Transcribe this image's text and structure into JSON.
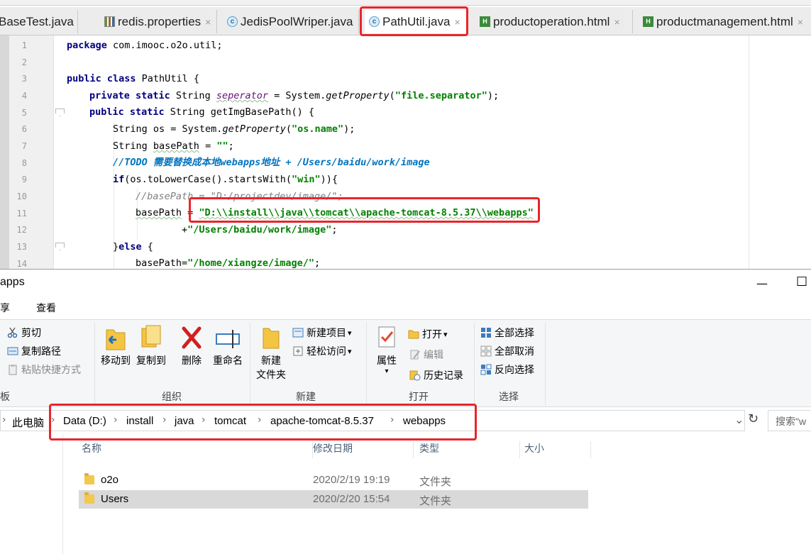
{
  "ide": {
    "tabs": [
      {
        "label": "BaseTest.java",
        "icon": "c"
      },
      {
        "label": "redis.properties",
        "icon": "prop"
      },
      {
        "label": "JedisPoolWriper.java",
        "icon": "c"
      },
      {
        "label": "PathUtil.java",
        "icon": "c",
        "active": true
      },
      {
        "label": "productoperation.html",
        "icon": "html"
      },
      {
        "label": "productmanagement.html",
        "icon": "html"
      }
    ],
    "close_glyph": "×",
    "line_numbers": [
      "1",
      "2",
      "3",
      "4",
      "5",
      "6",
      "7",
      "8",
      "9",
      "10",
      "11",
      "12",
      "13",
      "14"
    ],
    "code": {
      "l1_kw": "package",
      "l1_rest": " com.imooc.o2o.util;",
      "l3_kw": "public class",
      "l3_rest": " PathUtil {",
      "l4_kw": "private static",
      "l4_type": " String ",
      "l4_field": "seperator",
      "l4_eq": " = System.",
      "l4_call": "getProperty",
      "l4_open": "(",
      "l4_str": "\"file.separator\"",
      "l4_close": ");",
      "l5_kw": "public static",
      "l5_rest": " String getImgBasePath() {",
      "l6_a": "String os = System.",
      "l6_call": "getProperty",
      "l6_open": "(",
      "l6_str": "\"os.name\"",
      "l6_close": ");",
      "l7_a": "String ",
      "l7_var": "basePath",
      "l7_eq": " = ",
      "l7_str": "\"\"",
      "l7_close": ";",
      "l8_todo": "//TODO 需要替换成本地webapps地址 + /Users/baidu/work/image",
      "l9_kw": "if",
      "l9_a": "(os.toLowerCase().startsWith(",
      "l9_str": "\"win\"",
      "l9_close": ")){",
      "l10_cmt": "//basePath = \"D:/projectdev/image/\";",
      "l11_var": "basePath",
      "l11_eq": " = ",
      "l11_str": "\"D:\\\\install\\\\java\\\\tomcat\\\\apache-tomcat-8.5.37\\\\webapps\"",
      "l12_plus": "+",
      "l12_str": "\"/Users/baidu/work/image\"",
      "l12_close": ";",
      "l13_a": "}",
      "l13_kw": "else",
      "l13_close": " {",
      "l14_a": "basePath=",
      "l14_str": "\"/home/xiangze/image/\"",
      "l14_close": ";"
    }
  },
  "explorer": {
    "title": "apps",
    "window_buttons": {
      "minimize": "—",
      "maximize": "☐"
    },
    "menu": [
      "享",
      "查看"
    ],
    "ribbon": {
      "clipboard": {
        "cut": "剪切",
        "copy_path": "复制路径",
        "paste_shortcut": "粘贴快捷方式",
        "group_label": "板"
      },
      "organize": {
        "move_to": "移动到",
        "copy_to": "复制到",
        "delete": "删除",
        "rename": "重命名",
        "group_label": "组织"
      },
      "new": {
        "new_folder_1": "新建",
        "new_folder_2": "文件夹",
        "new_item": "新建项目",
        "easy_access": "轻松访问",
        "group_label": "新建"
      },
      "open": {
        "properties": "属性",
        "open": "打开",
        "edit": "编辑",
        "history": "历史记录",
        "group_label": "打开"
      },
      "select": {
        "select_all": "全部选择",
        "select_none": "全部取消",
        "invert": "反向选择",
        "group_label": "选择"
      },
      "dropdown_glyph": "▾"
    },
    "address": {
      "crumbs": [
        "此电脑",
        "Data (D:)",
        "install",
        "java",
        "tomcat",
        "apache-tomcat-8.5.37",
        "webapps"
      ],
      "separator": "›",
      "dropdown_glyph": "⌄",
      "refresh_glyph": "↻"
    },
    "search": {
      "placeholder": "搜索\"w"
    },
    "columns": {
      "name": "名称",
      "modified": "修改日期",
      "type": "类型",
      "size": "大小"
    },
    "files": [
      {
        "name": "o2o",
        "modified": "2020/2/19 19:19",
        "type": "文件夹"
      },
      {
        "name": "Users",
        "modified": "2020/2/20 15:54",
        "type": "文件夹",
        "selected": true
      }
    ]
  },
  "colors": {
    "highlight": "#e8252b",
    "keyword": "#000080",
    "string": "#008000",
    "comment": "#808080",
    "todo": "#0073bf"
  }
}
